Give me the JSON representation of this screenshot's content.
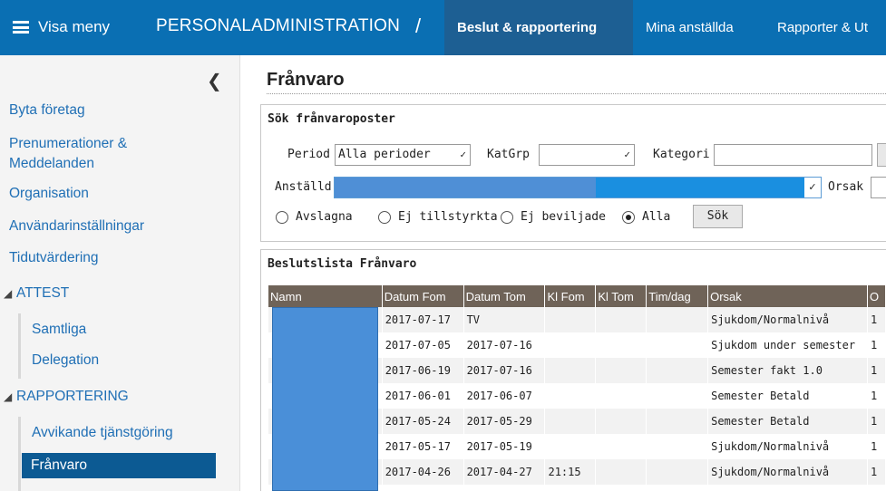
{
  "topbar": {
    "menu_label": "Visa meny",
    "app_title": "PERSONALADMINISTRATION",
    "separator": "/",
    "tabs": [
      {
        "label": "Beslut & rapportering",
        "active": true
      },
      {
        "label": "Mina anställda",
        "active": false
      },
      {
        "label": "Rapporter & Ut",
        "active": false
      }
    ],
    "accent": "#0a6fb3"
  },
  "sidebar": {
    "collapse_icon": "chevron-left-icon",
    "links": [
      "Byta företag",
      "Prenumerationer &",
      "Meddelanden",
      "Organisation",
      "Användarinställningar",
      "Tidutvärdering"
    ],
    "sections": [
      {
        "label": "ATTEST",
        "items": [
          "Samtliga",
          "Delegation"
        ]
      },
      {
        "label": "RAPPORTERING",
        "items": [
          "Avvikande tjänstgöring",
          "Frånvaro"
        ]
      }
    ],
    "active_item": "Frånvaro"
  },
  "main": {
    "title": "Frånvaro",
    "search": {
      "title": "Sök frånvaroposter",
      "period_label": "Period",
      "period_value": "Alla perioder",
      "katgrp_label": "KatGrp",
      "katgrp_value": "",
      "kategori_label": "Kategori",
      "anstalld_label": "Anställd",
      "orsak_label": "Orsak",
      "radios": [
        {
          "label": "Avslagna",
          "checked": false
        },
        {
          "label": "Ej tillstyrkta",
          "checked": false
        },
        {
          "label": "Ej beviljade",
          "checked": false
        },
        {
          "label": "Alla",
          "checked": true
        }
      ],
      "search_button": "Sök"
    },
    "list": {
      "title": "Beslutslista Frånvaro",
      "columns": [
        "Namn",
        "Datum Fom",
        "Datum Tom",
        "Kl Fom",
        "Kl Tom",
        "Tim/dag",
        "Orsak",
        "O"
      ],
      "rows": [
        {
          "fom": "2017-07-17",
          "tom": "TV",
          "klfom": "",
          "kltom": "",
          "timdag": "",
          "orsak": "Sjukdom/Normalnivå",
          "o": "1"
        },
        {
          "fom": "2017-07-05",
          "tom": "2017-07-16",
          "klfom": "",
          "kltom": "",
          "timdag": "",
          "orsak": "Sjukdom under semester",
          "o": "1"
        },
        {
          "fom": "2017-06-19",
          "tom": "2017-07-16",
          "klfom": "",
          "kltom": "",
          "timdag": "",
          "orsak": "Semester fakt 1.0",
          "o": "1"
        },
        {
          "fom": "2017-06-01",
          "tom": "2017-06-07",
          "klfom": "",
          "kltom": "",
          "timdag": "",
          "orsak": "Semester Betald",
          "o": "1"
        },
        {
          "fom": "2017-05-24",
          "tom": "2017-05-29",
          "klfom": "",
          "kltom": "",
          "timdag": "",
          "orsak": "Semester Betald",
          "o": "1"
        },
        {
          "fom": "2017-05-17",
          "tom": "2017-05-19",
          "klfom": "",
          "kltom": "",
          "timdag": "",
          "orsak": "Sjukdom/Normalnivå",
          "o": "1"
        },
        {
          "fom": "2017-04-26",
          "tom": "2017-04-27",
          "klfom": "21:15",
          "kltom": "",
          "timdag": "",
          "orsak": "Sjukdom/Normalnivå",
          "o": "1"
        }
      ]
    }
  }
}
